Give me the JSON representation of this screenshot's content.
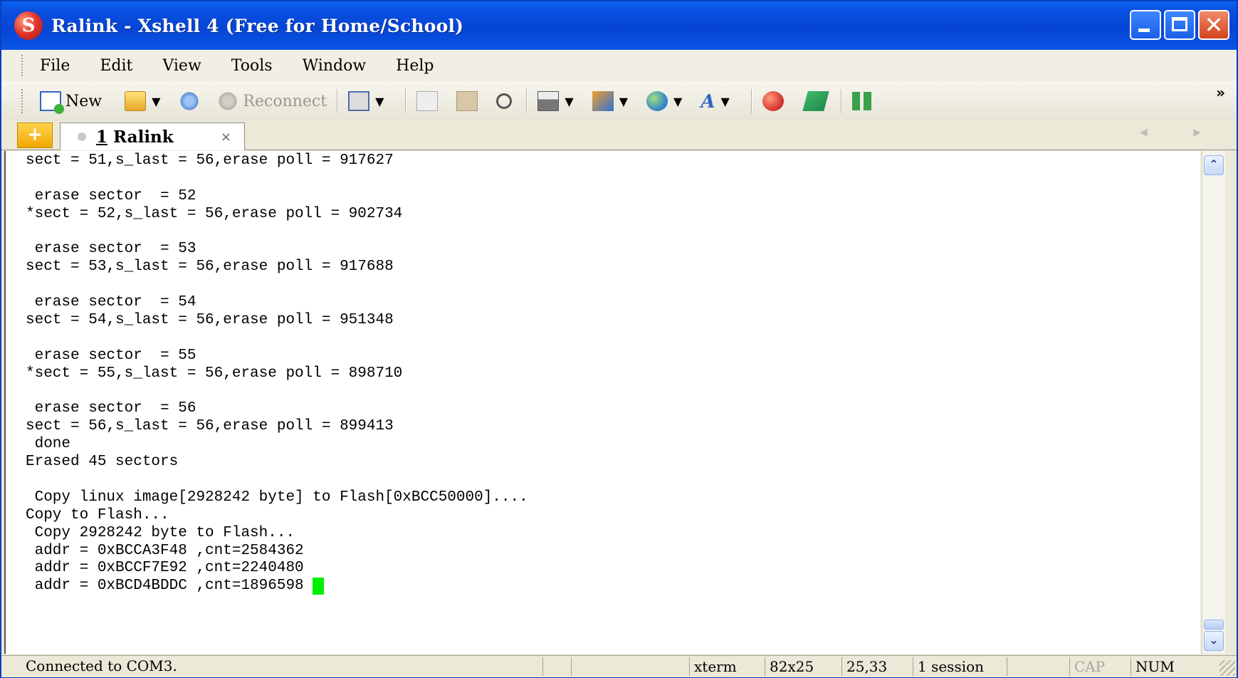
{
  "window": {
    "title": "Ralink - Xshell 4 (Free for Home/School)",
    "icon": "xshell-icon",
    "controls": [
      "minimize-icon",
      "maximize-icon",
      "close-icon"
    ]
  },
  "menu": {
    "items": [
      "File",
      "Edit",
      "View",
      "Tools",
      "Window",
      "Help"
    ]
  },
  "toolbar": {
    "new_label": "New",
    "reconnect_label": "Reconnect",
    "more_glyph": "»"
  },
  "tabs": {
    "add_glyph": "+",
    "active": {
      "number": "1",
      "label": "Ralink",
      "close_glyph": "×"
    },
    "nav": "◀ ▶"
  },
  "terminal": {
    "lines": [
      "sect = 51,s_last = 56,erase poll = 917627",
      "",
      " erase sector  = 52",
      "*sect = 52,s_last = 56,erase poll = 902734",
      "",
      " erase sector  = 53",
      "sect = 53,s_last = 56,erase poll = 917688",
      "",
      " erase sector  = 54",
      "sect = 54,s_last = 56,erase poll = 951348",
      "",
      " erase sector  = 55",
      "*sect = 55,s_last = 56,erase poll = 898710",
      "",
      " erase sector  = 56",
      "sect = 56,s_last = 56,erase poll = 899413",
      " done",
      "Erased 45 sectors",
      "",
      " Copy linux image[2928242 byte] to Flash[0xBCC50000]....",
      "Copy to Flash...",
      " Copy 2928242 byte to Flash...",
      " addr = 0xBCCA3F48 ,cnt=2584362",
      " addr = 0xBCCF7E92 ,cnt=2240480",
      " addr = 0xBCD4BDDC ,cnt=1896598 "
    ],
    "cursor_color": "#00ee00"
  },
  "status": {
    "text": "Connected to COM3.",
    "term": "xterm",
    "size": "82x25",
    "position": "25,33",
    "sessions": "1 session",
    "cap": "CAP",
    "num": "NUM"
  },
  "colors": {
    "titlebar": "#0645d4",
    "chrome": "#ece9d8",
    "terminal_bg": "#ffffff",
    "terminal_fg": "#000000"
  }
}
